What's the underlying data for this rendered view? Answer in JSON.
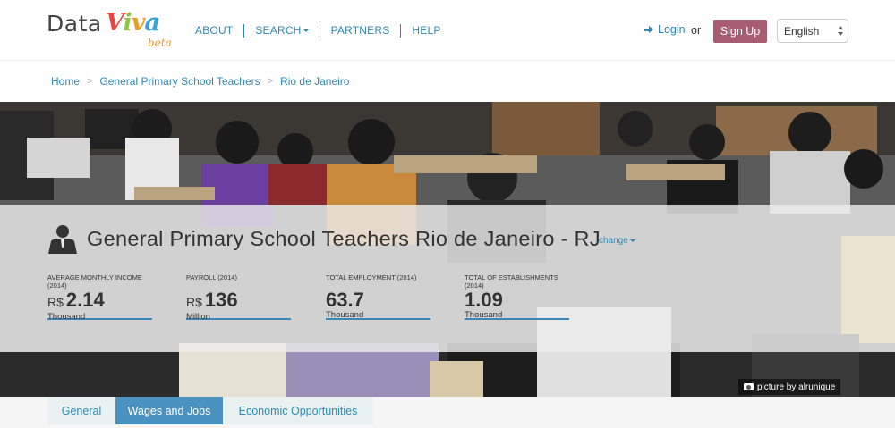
{
  "app": {
    "logo_data": "Data",
    "logo_viva": [
      "V",
      "i",
      "v",
      "a"
    ],
    "logo_beta": "beta"
  },
  "nav": {
    "items": [
      {
        "label": "ABOUT"
      },
      {
        "label": "SEARCH"
      },
      {
        "label": "PARTNERS"
      },
      {
        "label": "HELP"
      }
    ]
  },
  "account": {
    "login_label": "Login",
    "or_label": "or",
    "signup_label": "Sign Up",
    "language_selected": "English"
  },
  "breadcrumb": [
    "Home",
    "General Primary School Teachers",
    "Rio de Janeiro"
  ],
  "hero": {
    "title": "General Primary School Teachers Rio de Janeiro - RJ",
    "change_label": "change",
    "credit": "picture by alrunique",
    "stats": [
      {
        "label": "AVERAGE MONTHLY INCOME (2014)",
        "prefix": "R$",
        "value": "2.14",
        "unit": "Thousand"
      },
      {
        "label": "PAYROLL (2014)",
        "prefix": "R$",
        "value": "136",
        "unit": "Million"
      },
      {
        "label": "TOTAL EMPLOYMENT (2014)",
        "prefix": "",
        "value": "63.7",
        "unit": "Thousand"
      },
      {
        "label": "TOTAL OF ESTABLISHMENTS (2014)",
        "prefix": "",
        "value": "1.09",
        "unit": "Thousand"
      }
    ]
  },
  "tabs": [
    {
      "label": "General",
      "active": false
    },
    {
      "label": "Wages and Jobs",
      "active": true
    },
    {
      "label": "Economic Opportunities",
      "active": false
    }
  ],
  "colors": {
    "link": "#2e8ab5",
    "signup": "#a85c72",
    "accent": "#4a93c1"
  },
  "icons": [
    "login-icon",
    "person-icon",
    "camera-icon",
    "select-arrows-icon"
  ]
}
